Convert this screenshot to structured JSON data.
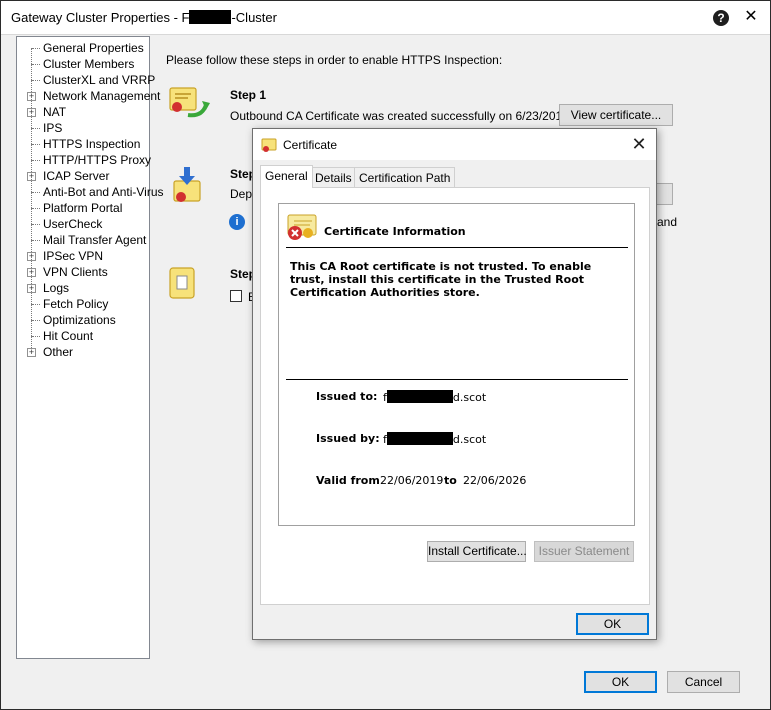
{
  "window": {
    "title_prefix": "Gateway Cluster Properties - ",
    "title_visible_part_1": "F",
    "title_visible_part_2": "-Cluster"
  },
  "tree": {
    "items": [
      {
        "label": "General Properties",
        "expandable": false
      },
      {
        "label": "Cluster Members",
        "expandable": false
      },
      {
        "label": "ClusterXL and VRRP",
        "expandable": false
      },
      {
        "label": "Network Management",
        "expandable": true
      },
      {
        "label": "NAT",
        "expandable": true
      },
      {
        "label": "IPS",
        "expandable": false
      },
      {
        "label": "HTTPS Inspection",
        "expandable": false,
        "selected": true
      },
      {
        "label": "HTTP/HTTPS Proxy",
        "expandable": false
      },
      {
        "label": "ICAP Server",
        "expandable": true
      },
      {
        "label": "Anti-Bot and Anti-Virus",
        "expandable": false
      },
      {
        "label": "Platform Portal",
        "expandable": false
      },
      {
        "label": "UserCheck",
        "expandable": false
      },
      {
        "label": "Mail Transfer Agent",
        "expandable": false
      },
      {
        "label": "IPSec VPN",
        "expandable": true
      },
      {
        "label": "VPN Clients",
        "expandable": true
      },
      {
        "label": "Logs",
        "expandable": true
      },
      {
        "label": "Fetch Policy",
        "expandable": false
      },
      {
        "label": "Optimizations",
        "expandable": false
      },
      {
        "label": "Hit Count",
        "expandable": false
      },
      {
        "label": "Other",
        "expandable": true
      }
    ]
  },
  "main": {
    "intro": "Please follow these steps in order to enable HTTPS Inspection:",
    "step1_title": "Step 1",
    "step1_text": "Outbound CA Certificate was created successfully on 6/23/2019",
    "view_certificate_label": "View certificate...",
    "step2_title_partial": "Step",
    "step2_text_partial": "Depl",
    "step2_right_partial": "and",
    "step3_title_partial": "Step",
    "step3_checkbox_partial": "E"
  },
  "footer": {
    "ok_label": "OK",
    "cancel_label": "Cancel"
  },
  "cert_dialog": {
    "title": "Certificate",
    "tabs": [
      "General",
      "Details",
      "Certification Path"
    ],
    "heading": "Certificate Information",
    "warning": "This CA Root certificate is not trusted. To enable trust, install this certificate in the Trusted Root Certification Authorities store.",
    "issued_to_label": "Issued to:",
    "issued_to_prefix": "f",
    "issued_to_suffix": "d.scot",
    "issued_by_label": "Issued by:",
    "issued_by_prefix": "f",
    "issued_by_suffix": "d.scot",
    "valid_from_label": "Valid from",
    "valid_from": "22/06/2019",
    "to_label": "to",
    "valid_to": "22/06/2026",
    "install_label": "Install Certificate...",
    "issuer_statement_label": "Issuer Statement",
    "ok_label": "OK"
  },
  "colors": {
    "accent": "#0078d7",
    "info_icon": "#1e6fd0",
    "cert_gold": "#e8b020",
    "error_red": "#d23030"
  }
}
